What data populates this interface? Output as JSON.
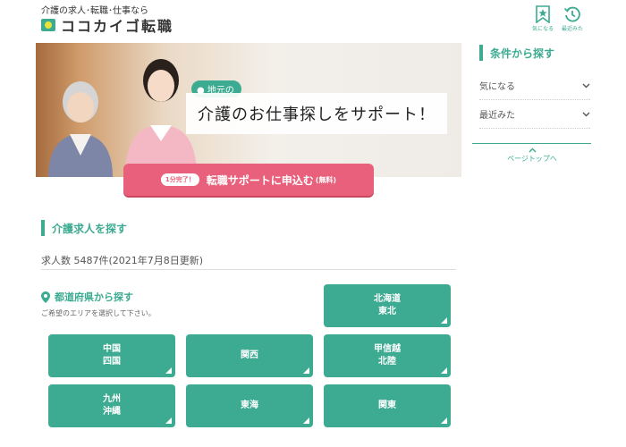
{
  "header": {
    "tagline": "介護の求人･転職･仕事なら",
    "logo_text": "ココカイゴ転職",
    "favorites_label": "気になる",
    "recent_label": "最近みた"
  },
  "hero": {
    "local_badge": "地元の",
    "copy": "介護のお仕事探しをサポート！",
    "cta_pill": "1分完了！",
    "cta_label": "転職サポートに申込む",
    "cta_free": "(無料)"
  },
  "search": {
    "title": "介護求人を探す",
    "count_text": "求人数 5487件(2021年7月8日更新)",
    "pref_title": "都道府県から探す",
    "pref_sub": "ご希望のエリアを選択して下さい。",
    "regions": [
      {
        "line1": "北海道",
        "line2": "東北"
      },
      {
        "line1": "中国",
        "line2": "四国"
      },
      {
        "line1": "関西",
        "line2": ""
      },
      {
        "line1": "甲信越",
        "line2": "北陸"
      },
      {
        "line1": "九州",
        "line2": "沖縄"
      },
      {
        "line1": "東海",
        "line2": ""
      },
      {
        "line1": "関東",
        "line2": ""
      }
    ]
  },
  "sidebar": {
    "title": "条件から探す",
    "items": [
      {
        "label": "気になる"
      },
      {
        "label": "最近みた"
      }
    ],
    "page_top": "ページトップへ"
  },
  "colors": {
    "accent": "#3cab91",
    "cta": "#e8607b",
    "logo_yellow": "#e9e23b"
  }
}
